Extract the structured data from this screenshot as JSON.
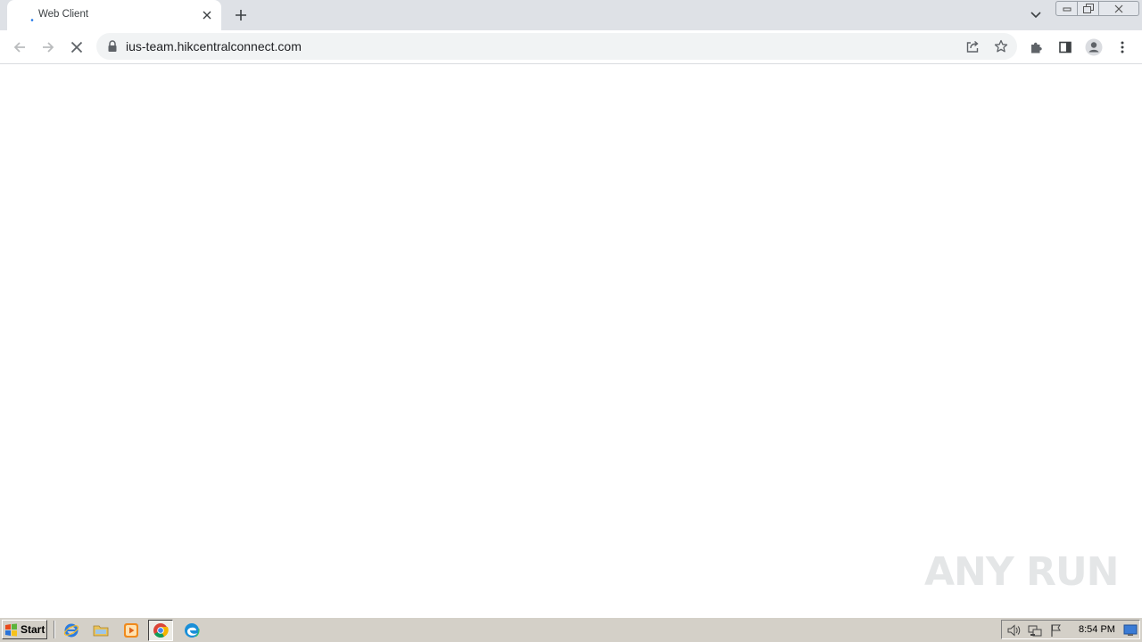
{
  "browser": {
    "tab": {
      "title": "Web Client"
    },
    "address_bar": {
      "url": "ius-team.hikcentralconnect.com"
    },
    "icons": {
      "back": "arrow-left-icon",
      "forward": "arrow-right-icon",
      "stop": "stop-loading-icon",
      "lock": "lock-icon",
      "share": "share-icon",
      "bookmark": "star-icon",
      "extensions": "puzzle-icon",
      "side_panel": "side-panel-icon",
      "profile": "profile-avatar-icon",
      "menu": "kebab-menu-icon"
    }
  },
  "watermark": {
    "text": "ANY RUN"
  },
  "taskbar": {
    "start_label": "Start",
    "quick_launch": [
      "internet-explorer-icon",
      "folder-icon",
      "media-player-icon",
      "chrome-icon",
      "edge-icon"
    ],
    "tray_icons": [
      "volume-icon",
      "network-icon",
      "action-center-flag-icon"
    ],
    "clock": "8:54 PM"
  },
  "colors": {
    "tabstrip_bg": "#dee1e6",
    "omnibox_bg": "#f1f3f4",
    "taskbar_bg": "#d4d0c8",
    "loading_accent": "#1a73e8"
  }
}
